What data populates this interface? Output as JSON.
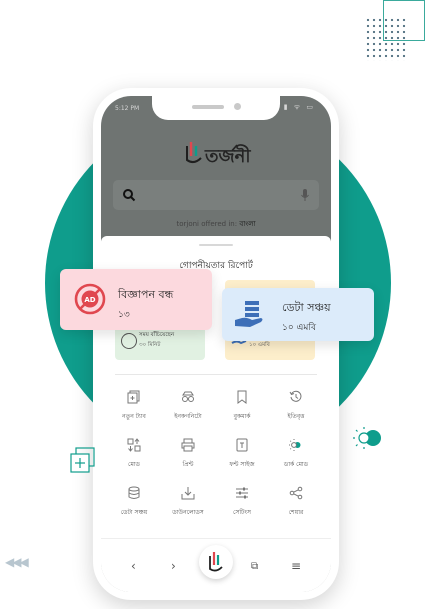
{
  "status": {
    "time": "5:12 PM",
    "icons": "▮ ᯤ ▭"
  },
  "app": {
    "logo_text": "তর্জনী"
  },
  "search": {
    "placeholder": ""
  },
  "offered": {
    "prefix": "torjoni offered in:",
    "language": "বাংলা"
  },
  "sheet": {
    "title": "গোপনীয়তার রিপোর্ট",
    "mini_left": {
      "label": "সময় বাঁচিয়েছেন",
      "value": "৩০ মিনিট"
    },
    "mini_right": {
      "value": "১০ এমবি"
    },
    "menu": [
      {
        "label": "নতুন ট্যাব",
        "icon": "new-tab-icon"
      },
      {
        "label": "ইনকগনিটো",
        "icon": "incognito-icon"
      },
      {
        "label": "বুকমার্ক",
        "icon": "bookmark-icon"
      },
      {
        "label": "ইতিবৃত্ত",
        "icon": "history-icon"
      },
      {
        "label": "মোড",
        "icon": "mode-icon"
      },
      {
        "label": "প্রিন্ট",
        "icon": "print-icon"
      },
      {
        "label": "ফন্ট সাইজ",
        "icon": "font-size-icon"
      },
      {
        "label": "ডার্ক মোড",
        "icon": "dark-mode-icon"
      },
      {
        "label": "ডেটা সঞ্চয়",
        "icon": "data-saver-icon"
      },
      {
        "label": "ডাউনলোডস",
        "icon": "downloads-icon"
      },
      {
        "label": "সেটিংস",
        "icon": "settings-icon"
      },
      {
        "label": "শেয়ার",
        "icon": "share-icon"
      }
    ]
  },
  "nav": {
    "back": "‹",
    "forward": "›",
    "tabs": "⧉",
    "menu": "≡"
  },
  "cards": {
    "ad": {
      "title": "বিজ্ঞাপন বন্ধ",
      "value": "১৩"
    },
    "data": {
      "title": "ডেটা সঞ্চয়",
      "value": "১০ এমবি"
    }
  },
  "colors": {
    "teal": "#0f9d8c",
    "accent_red": "#e0474f",
    "accent_blue": "#3d6fb8"
  }
}
